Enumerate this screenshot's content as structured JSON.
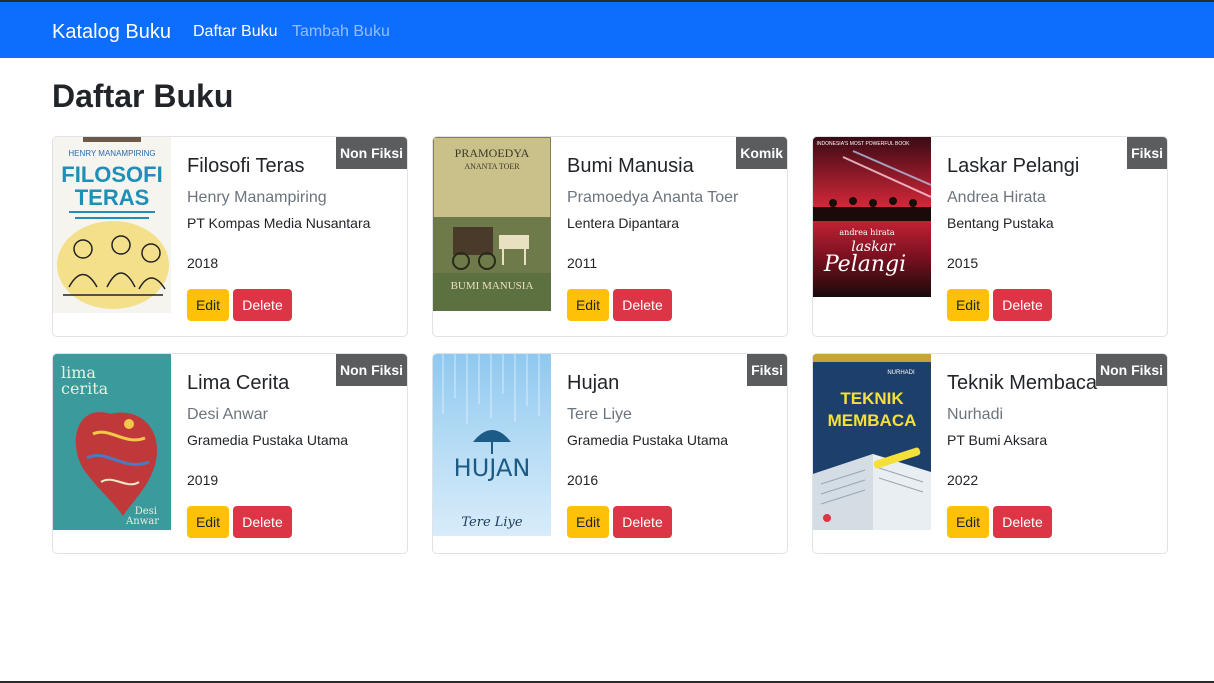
{
  "nav": {
    "brand": "Katalog Buku",
    "links": [
      {
        "label": "Daftar Buku",
        "active": true
      },
      {
        "label": "Tambah Buku",
        "active": false
      }
    ]
  },
  "page_title": "Daftar Buku",
  "books": [
    {
      "title": "Filosofi Teras",
      "author": "Henry Manampiring",
      "publisher": "PT Kompas Media Nusantara",
      "year": "2018",
      "category": "Non Fiksi",
      "cover_text": {
        "author": "HENRY MANAMPIRING",
        "title_1": "FILOSOFI",
        "title_2": "TERAS"
      }
    },
    {
      "title": "Bumi Manusia",
      "author": "Pramoedya Ananta Toer",
      "publisher": "Lentera Dipantara",
      "year": "2011",
      "category": "Komik",
      "cover_text": {
        "author_1": "PRAMOEDYA",
        "author_2": "ANANTA TOER",
        "title": "BUMI MANUSIA"
      }
    },
    {
      "title": "Laskar Pelangi",
      "author": "Andrea Hirata",
      "publisher": "Bentang Pustaka",
      "year": "2015",
      "category": "Fiksi",
      "cover_text": {
        "tagline": "INDONESIA'S MOST POWERFUL BOOK",
        "author": "andrea hirata",
        "title_1": "laskar",
        "title_2": "Pelangi"
      }
    },
    {
      "title": "Lima Cerita",
      "author": "Desi Anwar",
      "publisher": "Gramedia Pustaka Utama",
      "year": "2019",
      "category": "Non Fiksi",
      "cover_text": {
        "title_1": "lima",
        "title_2": "cerita",
        "author_1": "Desi",
        "author_2": "Anwar"
      }
    },
    {
      "title": "Hujan",
      "author": "Tere Liye",
      "publisher": "Gramedia Pustaka Utama",
      "year": "2016",
      "category": "Fiksi",
      "cover_text": {
        "title": "HUJAN",
        "author": "Tere Liye"
      }
    },
    {
      "title": "Teknik Membaca",
      "author": "Nurhadi",
      "publisher": "PT Bumi Aksara",
      "year": "2022",
      "category": "Non Fiksi",
      "cover_text": {
        "author": "NURHADI",
        "title_1": "TEKNIK",
        "title_2": "MEMBACA"
      }
    }
  ],
  "buttons": {
    "edit": "Edit",
    "delete": "Delete"
  },
  "colors": {
    "navbar": "#0d6efd",
    "badge": "#5a5c5e",
    "edit": "#ffc107",
    "delete": "#dc3545"
  }
}
